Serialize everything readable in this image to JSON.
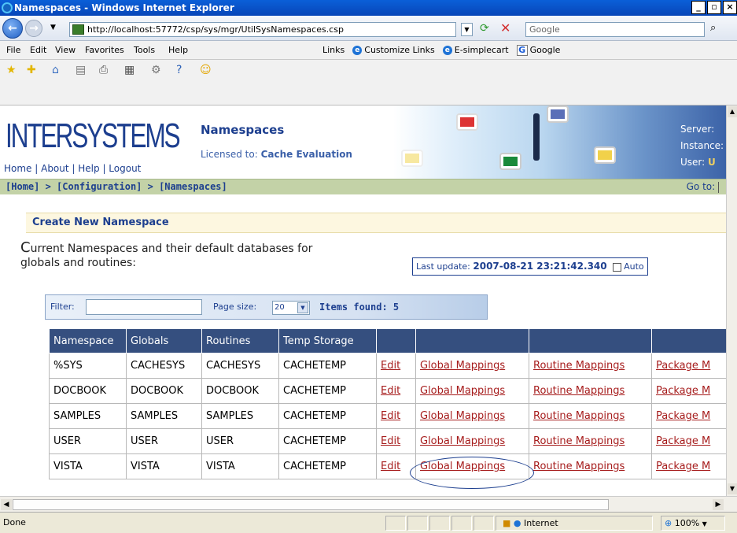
{
  "window": {
    "title": "Namespaces - Windows Internet Explorer"
  },
  "address": {
    "url": "http://localhost:57772/csp/sys/mgr/UtilSysNamespaces.csp",
    "search_placeholder": "Google"
  },
  "menu": {
    "items": [
      "File",
      "Edit",
      "View",
      "Favorites",
      "Tools",
      "Help"
    ]
  },
  "links": {
    "label": "Links",
    "items": [
      "Customize Links",
      "E-simplecart",
      "Google"
    ]
  },
  "header": {
    "logo": "INTERSYSTEMS",
    "top_links": [
      "Home",
      "About",
      "Help",
      "Logout"
    ],
    "page_title": "Namespaces",
    "licensed_label": "Licensed to:",
    "licensed_value": "Cache Evaluation",
    "server_label": "Server:",
    "instance_label": "Instance:",
    "user_label": "User:",
    "user_value": "U"
  },
  "breadcrumb": {
    "text": "[Home] > [Configuration] > [Namespaces]",
    "goto_label": "Go to:"
  },
  "create": {
    "label": "Create New Namespace"
  },
  "description": {
    "first": "C",
    "rest": "urrent Namespaces and their default databases for",
    "line2": "globals and routines:"
  },
  "last_update": {
    "label": "Last update:",
    "value": "2007-08-21 23:21:42.340",
    "auto_label": "Auto"
  },
  "filter": {
    "label": "Filter:",
    "page_size_label": "Page size:",
    "page_size": "20",
    "items_found": "Items found: 5"
  },
  "table": {
    "headers": [
      "Namespace",
      "Globals",
      "Routines",
      "Temp Storage",
      "",
      "",
      "",
      ""
    ],
    "rows": [
      [
        "%SYS",
        "CACHESYS",
        "CACHESYS",
        "CACHETEMP",
        "Edit",
        "Global Mappings",
        "Routine Mappings",
        "Package M"
      ],
      [
        "DOCBOOK",
        "DOCBOOK",
        "DOCBOOK",
        "CACHETEMP",
        "Edit",
        "Global Mappings",
        "Routine Mappings",
        "Package M"
      ],
      [
        "SAMPLES",
        "SAMPLES",
        "SAMPLES",
        "CACHETEMP",
        "Edit",
        "Global Mappings",
        "Routine Mappings",
        "Package M"
      ],
      [
        "USER",
        "USER",
        "USER",
        "CACHETEMP",
        "Edit",
        "Global Mappings",
        "Routine Mappings",
        "Package M"
      ],
      [
        "VISTA",
        "VISTA",
        "VISTA",
        "CACHETEMP",
        "Edit",
        "Global Mappings",
        "Routine Mappings",
        "Package M"
      ]
    ]
  },
  "status": {
    "left": "Done",
    "zone": "Internet",
    "zoom": "100%"
  },
  "colors": {
    "header_blue": "#1d3f8f",
    "table_header": "#354f7f",
    "link": "#a61c1c",
    "breadcrumb_bg": "#c3d2a7"
  }
}
